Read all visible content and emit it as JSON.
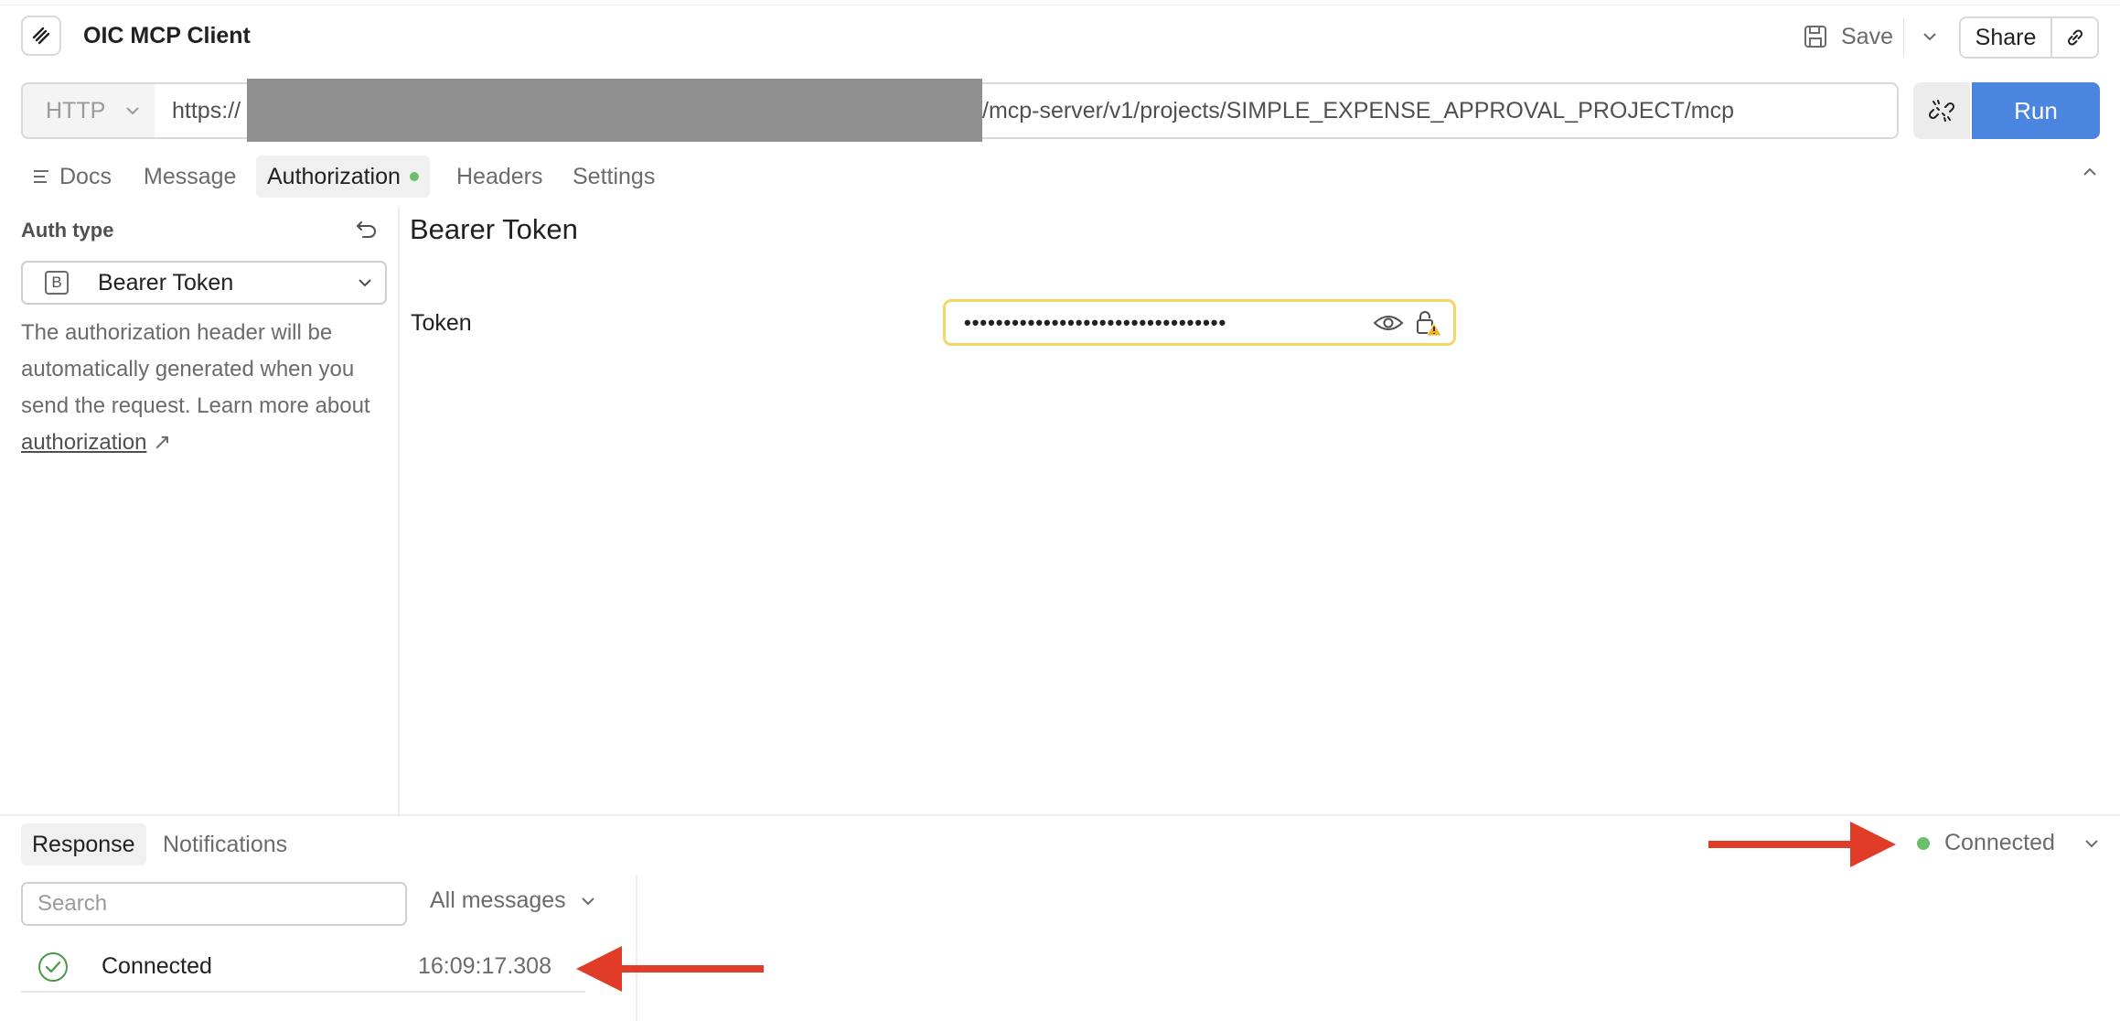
{
  "app": {
    "title": "OIC MCP Client"
  },
  "header": {
    "save_label": "Save",
    "share_label": "Share"
  },
  "request": {
    "method": "HTTP",
    "url_prefix": "https://",
    "url_suffix": "/mcp-server/v1/projects/SIMPLE_EXPENSE_APPROVAL_PROJECT/mcp",
    "run_label": "Run"
  },
  "tabs": [
    {
      "label": "Docs"
    },
    {
      "label": "Message"
    },
    {
      "label": "Authorization"
    },
    {
      "label": "Headers"
    },
    {
      "label": "Settings"
    }
  ],
  "auth": {
    "type_label": "Auth type",
    "selected": "Bearer Token",
    "badge": "B",
    "description": "The authorization header will be automatically generated when you send the request. Learn more about ",
    "link_text": "authorization",
    "link_arrow": "↗"
  },
  "bearer": {
    "title": "Bearer Token",
    "token_label": "Token",
    "token_masked": "•••••••••••••••••••••••••••••••••"
  },
  "response": {
    "tabs": [
      {
        "label": "Response"
      },
      {
        "label": "Notifications"
      }
    ],
    "status": "Connected",
    "status_color": "#6cbd6c",
    "search_placeholder": "Search",
    "filter_label": "All messages",
    "messages": [
      {
        "text": "Connected",
        "time": "16:09:17.308"
      }
    ]
  },
  "colors": {
    "accent": "#4a86e0",
    "arrow": "#e03c28",
    "token_border": "#f5d46a"
  }
}
